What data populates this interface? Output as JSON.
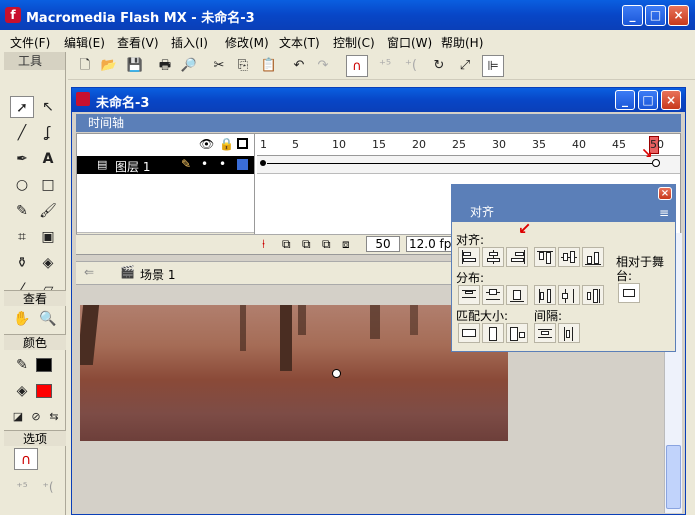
{
  "app": {
    "title": "Macromedia Flash MX - 未命名-3",
    "logo_glyph": "f",
    "window_controls": [
      "_",
      "□",
      "×"
    ]
  },
  "menu": [
    "文件(F)",
    "编辑(E)",
    "查看(V)",
    "插入(I)",
    "修改(M)",
    "文本(T)",
    "控制(C)",
    "窗口(W)",
    "帮助(H)"
  ],
  "tools": {
    "header": "工具",
    "view_label": "查看",
    "colors_label": "颜色",
    "options_label": "选项",
    "stroke_color": "#000000",
    "fill_color": "#ff0000"
  },
  "document": {
    "title": "未命名-3",
    "timeline_title": "时间轴",
    "layer_name": "图层 1",
    "frame_numbers": [
      "1",
      "5",
      "10",
      "15",
      "20",
      "25",
      "30",
      "35",
      "40",
      "45",
      "50"
    ],
    "current_frame": "50",
    "fps": "12.0 fp",
    "scene_label": "场景 1"
  },
  "align_panel": {
    "title": "对齐",
    "align_label": "对齐:",
    "distribute_label": "分布:",
    "match_size_label": "匹配大小:",
    "spacing_label": "间隔:",
    "relative_to_stage_label": "相对于舞台:"
  },
  "colors": {
    "xp_title_blue": "#0846c7",
    "panel_blue": "#5b7fb8",
    "playhead_red": "#e86060"
  }
}
